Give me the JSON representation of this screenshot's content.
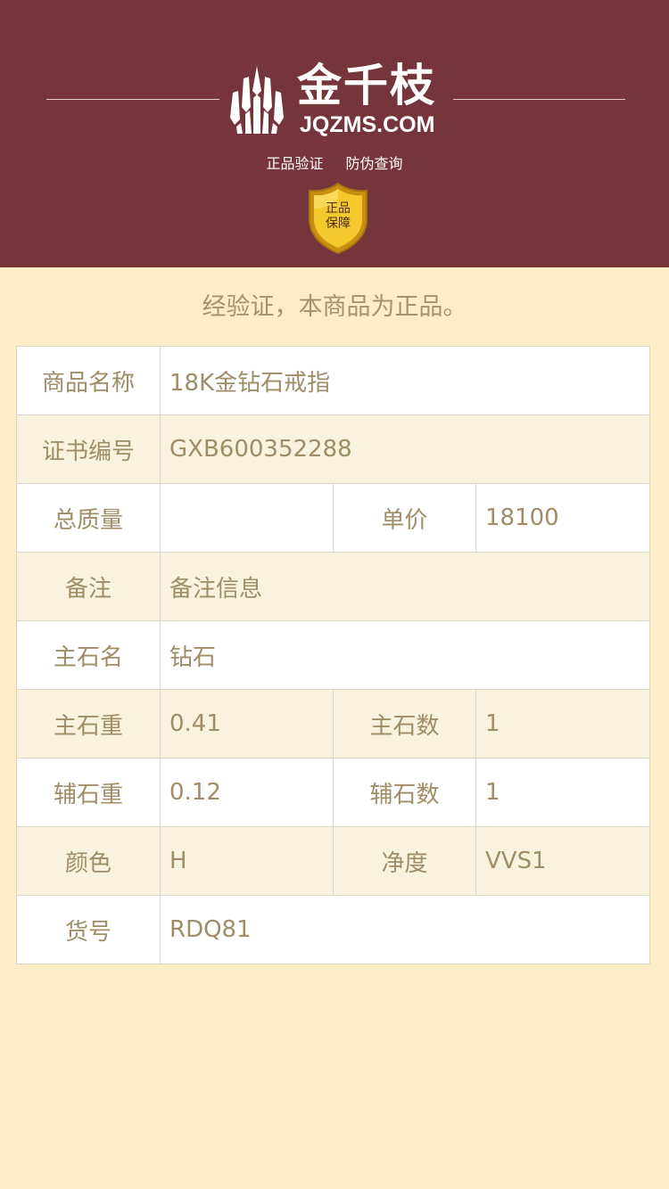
{
  "header": {
    "brand_cn": "金千枝",
    "brand_en": "JQZMS.COM",
    "subtitle_items": [
      "正品验证",
      "防伪查询"
    ],
    "badge_lines": [
      "正品",
      "保障"
    ],
    "colors": {
      "background": "#76353a",
      "badge_gold": "#f3c52c",
      "badge_border": "#c98f0f"
    }
  },
  "verified_text": "经验证，本商品为正品。",
  "table": {
    "product_name": {
      "label": "商品名称",
      "value": "18K金钻石戒指"
    },
    "certificate_no": {
      "label": "证书编号",
      "value": "GXB600352288"
    },
    "total_weight": {
      "label": "总质量",
      "value": ""
    },
    "unit_price": {
      "label": "单价",
      "value": "18100"
    },
    "remark": {
      "label": "备注",
      "value": "备注信息"
    },
    "main_stone_name": {
      "label": "主石名",
      "value": "钻石"
    },
    "main_stone_weight": {
      "label": "主石重",
      "value": "0.41"
    },
    "main_stone_count": {
      "label": "主石数",
      "value": "1"
    },
    "side_stone_weight": {
      "label": "辅石重",
      "value": "0.12"
    },
    "side_stone_count": {
      "label": "辅石数",
      "value": "1"
    },
    "color": {
      "label": "颜色",
      "value": "H"
    },
    "clarity": {
      "label": "净度",
      "value": "VVS1"
    },
    "item_no": {
      "label": "货号",
      "value": "RDQ81"
    }
  },
  "colors": {
    "page_background": "#fcedc6",
    "text": "#a08d67",
    "row_alt": "#f8f2df",
    "border": "#dcd6c6"
  }
}
